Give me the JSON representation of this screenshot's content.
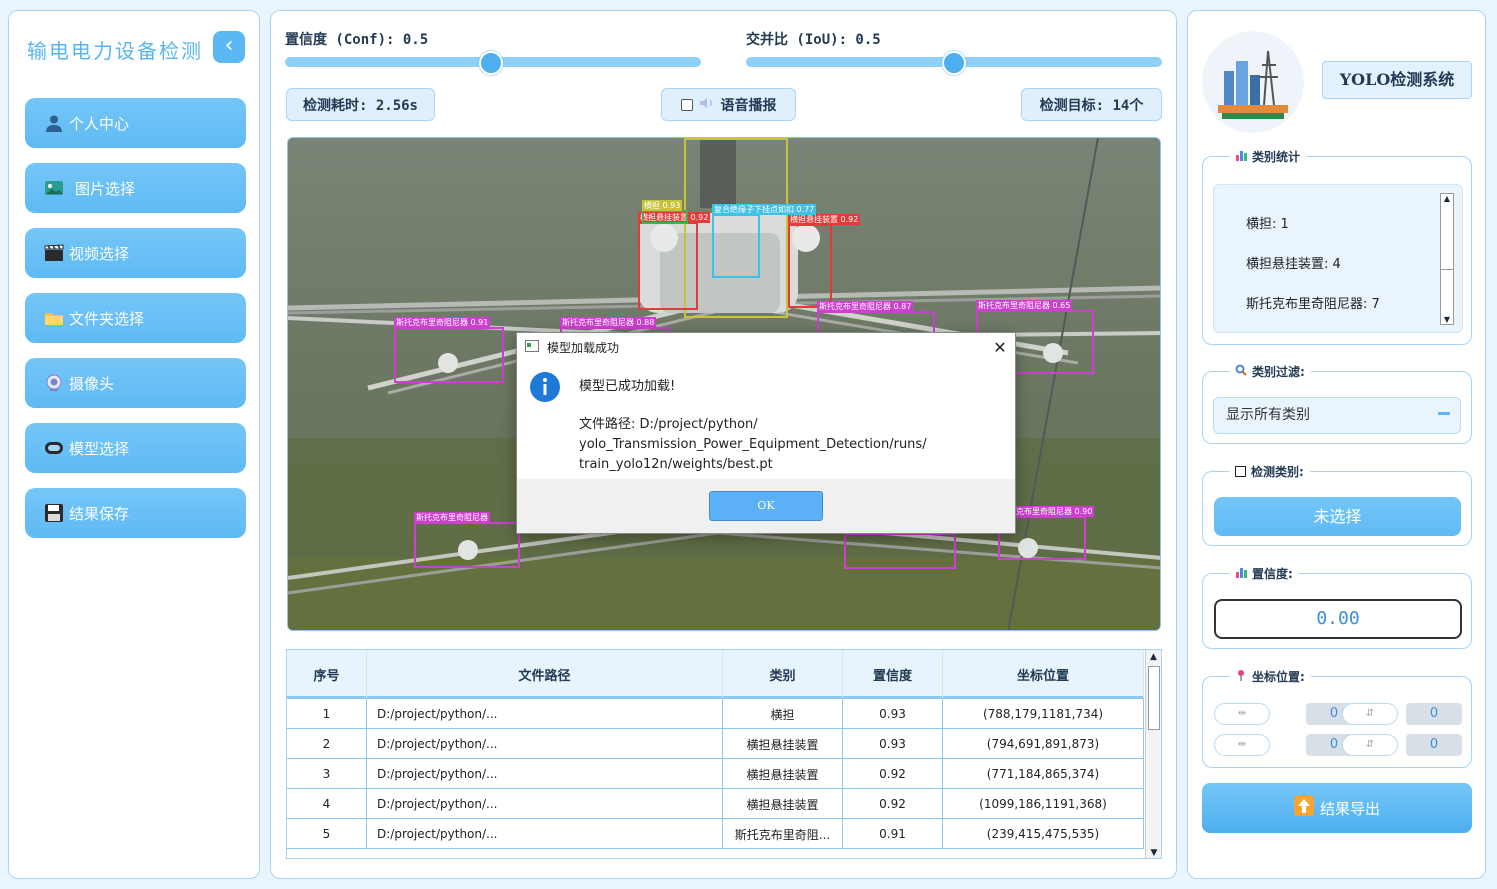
{
  "sidebar": {
    "title": "输电电力设备检测",
    "collapse_icon": "chevron-left-icon",
    "items": [
      {
        "label": "个人中心",
        "icon": "user-icon"
      },
      {
        "label": "图片选择",
        "icon": "image-icon"
      },
      {
        "label": "视频选择",
        "icon": "clapper-icon"
      },
      {
        "label": "文件夹选择",
        "icon": "folder-icon"
      },
      {
        "label": "摄像头",
        "icon": "camera-icon"
      },
      {
        "label": "模型选择",
        "icon": "model-icon"
      },
      {
        "label": "结果保存",
        "icon": "save-icon"
      }
    ]
  },
  "controls": {
    "conf_label": "置信度 (Conf): 0.5",
    "conf_value": 0.5,
    "iou_label": "交并比 (IoU): 0.5",
    "iou_value": 0.5,
    "time_label": "检测耗时: 2.56s",
    "voice_label": "语音播报",
    "voice_checked": false,
    "target_label": "检测目标: 14个"
  },
  "detections": [
    {
      "label": "横担 0.93",
      "color": "#c7c43a"
    },
    {
      "label": "横担悬挂装置 0.92",
      "color": "#e53a3a"
    },
    {
      "label": "横担悬挂装置 0.92",
      "color": "#e53a3a"
    },
    {
      "label": "复合绝缘子下挂点如扣 0.77",
      "color": "#3ec2e8"
    },
    {
      "label": "斯托克布里奇阻尼器 0.91",
      "color": "#cc3fcf"
    },
    {
      "label": "斯托克布里奇阻尼器 0.88",
      "color": "#cc3fcf"
    },
    {
      "label": "斯托克布里奇阻尼器 0.87",
      "color": "#cc3fcf"
    },
    {
      "label": "斯托克布里奇阻尼器 0.65",
      "color": "#cc3fcf"
    },
    {
      "label": "斯托克布里奇阻尼器",
      "color": "#cc3fcf"
    },
    {
      "label": "斯托克布里奇阻尼器 0.90",
      "color": "#cc3fcf"
    }
  ],
  "dialog": {
    "title": "模型加载成功",
    "message": "模型已成功加载!",
    "path_line1": "文件路径: D:/project/python/",
    "path_line2": "yolo_Transmission_Power_Equipment_Detection/runs/",
    "path_line3": "train_yolo12n/weights/best.pt",
    "ok_label": "OK"
  },
  "table": {
    "headers": [
      "序号",
      "文件路径",
      "类别",
      "置信度",
      "坐标位置"
    ],
    "rows": [
      [
        "1",
        "D:/project/python/...",
        "横担",
        "0.93",
        "(788,179,1181,734)"
      ],
      [
        "2",
        "D:/project/python/...",
        "横担悬挂装置",
        "0.93",
        "(794,691,891,873)"
      ],
      [
        "3",
        "D:/project/python/...",
        "横担悬挂装置",
        "0.92",
        "(771,184,865,374)"
      ],
      [
        "4",
        "D:/project/python/...",
        "横担悬挂装置",
        "0.92",
        "(1099,186,1191,368)"
      ],
      [
        "5",
        "D:/project/python/...",
        "斯托克布里奇阻...",
        "0.91",
        "(239,415,475,535)"
      ]
    ]
  },
  "right": {
    "system_title": "YOLO检测系统",
    "stats_title": "类别统计",
    "stats": [
      "横担: 1",
      "横担悬挂装置: 4",
      "斯托克布里奇阻尼器: 7"
    ],
    "filter_title": "类别过滤:",
    "filter_value": "显示所有类别",
    "class_title": "检测类别:",
    "class_button": "未选择",
    "conf_title": "置信度:",
    "conf_value": "0.00",
    "coord_title": "坐标位置:",
    "coords": {
      "xmin": "0",
      "ymin": "0",
      "xmax": "0",
      "ymax": "0"
    },
    "export_label": "结果导出"
  },
  "colors": {
    "accent": "#5cb8f3",
    "panel_border": "#a9d4f5",
    "detection_magenta": "#cc3fcf",
    "detection_red": "#e53a3a"
  }
}
